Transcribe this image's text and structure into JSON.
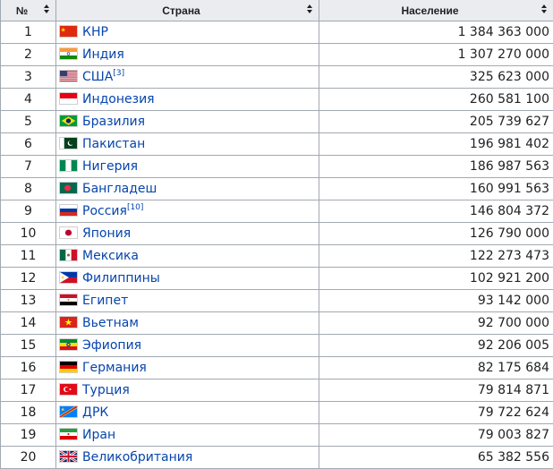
{
  "table": {
    "headers": {
      "num": "№",
      "country": "Страна",
      "population": "Население"
    },
    "rows": [
      {
        "num": "1",
        "country": "КНР",
        "ref": "",
        "population": "1 384 363 000",
        "flag": "china-flag-icon"
      },
      {
        "num": "2",
        "country": "Индия",
        "ref": "",
        "population": "1 307 270 000",
        "flag": "india-flag-icon"
      },
      {
        "num": "3",
        "country": "США",
        "ref": "[3]",
        "population": "325 623 000",
        "flag": "usa-flag-icon"
      },
      {
        "num": "4",
        "country": "Индонезия",
        "ref": "",
        "population": "260 581 100",
        "flag": "indonesia-flag-icon"
      },
      {
        "num": "5",
        "country": "Бразилия",
        "ref": "",
        "population": "205 739 627",
        "flag": "brazil-flag-icon"
      },
      {
        "num": "6",
        "country": "Пакистан",
        "ref": "",
        "population": "196 981 402",
        "flag": "pakistan-flag-icon"
      },
      {
        "num": "7",
        "country": "Нигерия",
        "ref": "",
        "population": "186 987 563",
        "flag": "nigeria-flag-icon"
      },
      {
        "num": "8",
        "country": "Бангладеш",
        "ref": "",
        "population": "160 991 563",
        "flag": "bangladesh-flag-icon"
      },
      {
        "num": "9",
        "country": "Россия",
        "ref": "[10]",
        "population": "146 804 372",
        "flag": "russia-flag-icon"
      },
      {
        "num": "10",
        "country": "Япония",
        "ref": "",
        "population": "126 790 000",
        "flag": "japan-flag-icon"
      },
      {
        "num": "11",
        "country": "Мексика",
        "ref": "",
        "population": "122 273 473",
        "flag": "mexico-flag-icon"
      },
      {
        "num": "12",
        "country": "Филиппины",
        "ref": "",
        "population": "102 921 200",
        "flag": "philippines-flag-icon"
      },
      {
        "num": "13",
        "country": "Египет",
        "ref": "",
        "population": "93 142 000",
        "flag": "egypt-flag-icon"
      },
      {
        "num": "14",
        "country": "Вьетнам",
        "ref": "",
        "population": "92 700 000",
        "flag": "vietnam-flag-icon"
      },
      {
        "num": "15",
        "country": "Эфиопия",
        "ref": "",
        "population": "92 206 005",
        "flag": "ethiopia-flag-icon"
      },
      {
        "num": "16",
        "country": "Германия",
        "ref": "",
        "population": "82 175 684",
        "flag": "germany-flag-icon"
      },
      {
        "num": "17",
        "country": "Турция",
        "ref": "",
        "population": "79 814 871",
        "flag": "turkey-flag-icon"
      },
      {
        "num": "18",
        "country": "ДРК",
        "ref": "",
        "population": "79 722 624",
        "flag": "drc-flag-icon"
      },
      {
        "num": "19",
        "country": "Иран",
        "ref": "",
        "population": "79 003 827",
        "flag": "iran-flag-icon"
      },
      {
        "num": "20",
        "country": "Великобритания",
        "ref": "",
        "population": "65 382 556",
        "flag": "uk-flag-icon"
      }
    ]
  }
}
